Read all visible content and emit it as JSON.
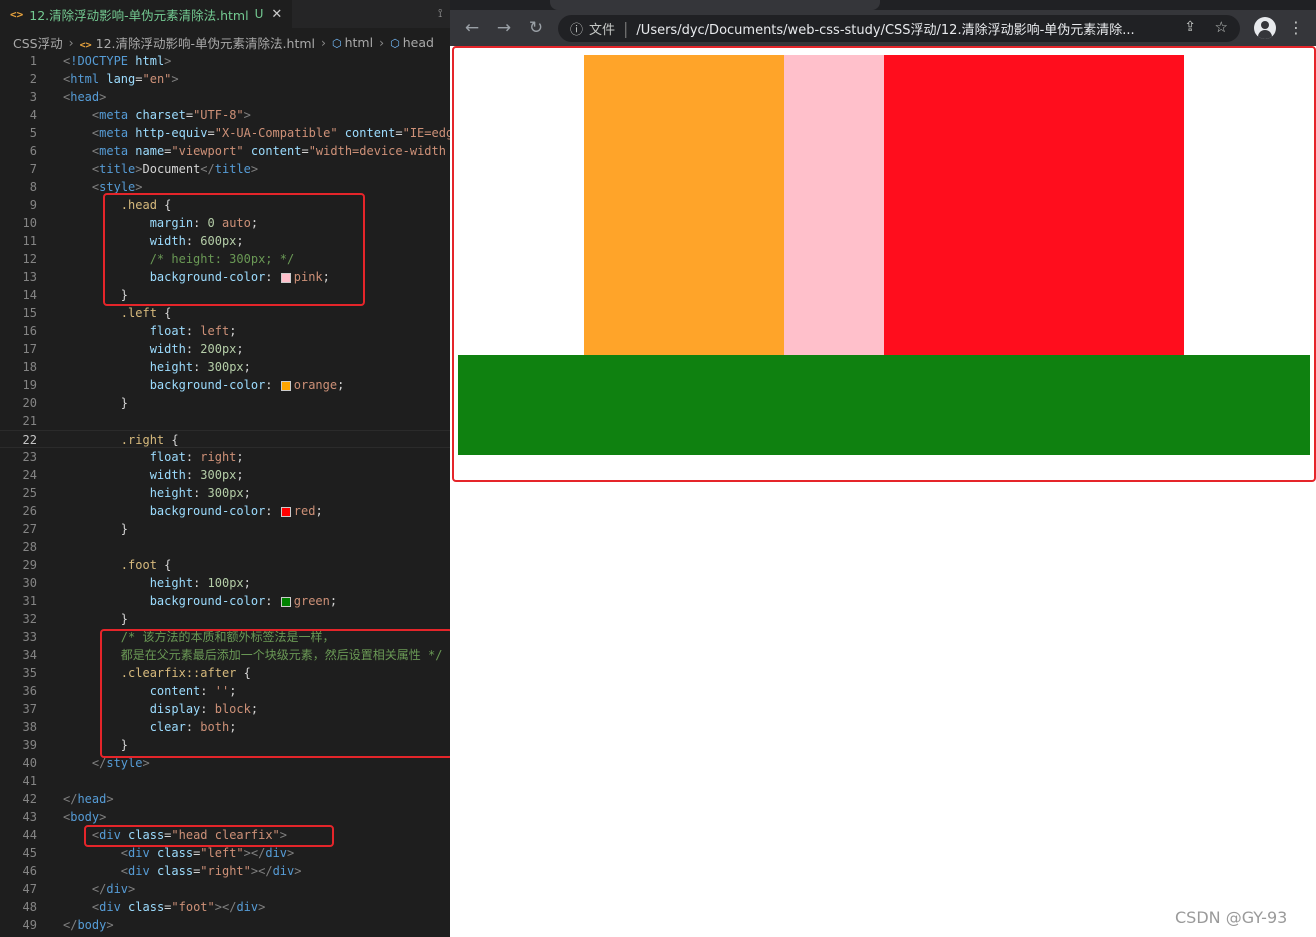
{
  "editor": {
    "tab": {
      "icon": "<>",
      "filename": "12.清除浮动影响-单伪元素清除法.html",
      "status": "U",
      "close": "✕"
    },
    "breadcrumb": [
      {
        "label": "CSS浮动",
        "icon": ""
      },
      {
        "label": "12.清除浮动影响-单伪元素清除法.html",
        "icon": "html-file-icon"
      },
      {
        "label": "html",
        "icon": "cube-icon"
      },
      {
        "label": "head",
        "icon": "cube-icon"
      }
    ],
    "current_line": 22,
    "lines": [
      [
        [
          "t-punc",
          "<"
        ],
        [
          "t-tag",
          "!DOCTYPE "
        ],
        [
          "t-attr",
          "html"
        ],
        [
          "t-punc",
          ">"
        ]
      ],
      [
        [
          "t-punc",
          "<"
        ],
        [
          "t-tag",
          "html "
        ],
        [
          "t-attr",
          "lang"
        ],
        [
          "t-plain",
          "="
        ],
        [
          "t-str",
          "\"en\""
        ],
        [
          "t-punc",
          ">"
        ]
      ],
      [
        [
          "t-punc",
          "<"
        ],
        [
          "t-tag",
          "head"
        ],
        [
          "t-punc",
          ">"
        ]
      ],
      [
        [
          "t-plain",
          "    "
        ],
        [
          "t-punc",
          "<"
        ],
        [
          "t-tag",
          "meta "
        ],
        [
          "t-attr",
          "charset"
        ],
        [
          "t-plain",
          "="
        ],
        [
          "t-str",
          "\"UTF-8\""
        ],
        [
          "t-punc",
          ">"
        ]
      ],
      [
        [
          "t-plain",
          "    "
        ],
        [
          "t-punc",
          "<"
        ],
        [
          "t-tag",
          "meta "
        ],
        [
          "t-attr",
          "http-equiv"
        ],
        [
          "t-plain",
          "="
        ],
        [
          "t-str",
          "\"X-UA-Compatible\" "
        ],
        [
          "t-attr",
          "content"
        ],
        [
          "t-plain",
          "="
        ],
        [
          "t-str",
          "\"IE=edge\""
        ]
      ],
      [
        [
          "t-plain",
          "    "
        ],
        [
          "t-punc",
          "<"
        ],
        [
          "t-tag",
          "meta "
        ],
        [
          "t-attr",
          "name"
        ],
        [
          "t-plain",
          "="
        ],
        [
          "t-str",
          "\"viewport\" "
        ],
        [
          "t-attr",
          "content"
        ],
        [
          "t-plain",
          "="
        ],
        [
          "t-str",
          "\"width=device-width"
        ]
      ],
      [
        [
          "t-plain",
          "    "
        ],
        [
          "t-punc",
          "<"
        ],
        [
          "t-tag",
          "title"
        ],
        [
          "t-punc",
          ">"
        ],
        [
          "t-plain",
          "Document"
        ],
        [
          "t-punc",
          "</"
        ],
        [
          "t-tag",
          "title"
        ],
        [
          "t-punc",
          ">"
        ]
      ],
      [
        [
          "t-plain",
          "    "
        ],
        [
          "t-punc",
          "<"
        ],
        [
          "t-tag",
          "style"
        ],
        [
          "t-punc",
          ">"
        ]
      ],
      [
        [
          "t-plain",
          "        "
        ],
        [
          "t-sel",
          ".head "
        ],
        [
          "t-plain",
          "{"
        ]
      ],
      [
        [
          "t-plain",
          "            "
        ],
        [
          "t-prop",
          "margin"
        ],
        [
          "t-plain",
          ": "
        ],
        [
          "t-num",
          "0 "
        ],
        [
          "t-val",
          "auto"
        ],
        [
          "t-plain",
          ";"
        ]
      ],
      [
        [
          "t-plain",
          "            "
        ],
        [
          "t-prop",
          "width"
        ],
        [
          "t-plain",
          ": "
        ],
        [
          "t-num",
          "600px"
        ],
        [
          "t-plain",
          ";"
        ]
      ],
      [
        [
          "t-plain",
          "            "
        ],
        [
          "t-com",
          "/* height: 300px; */"
        ]
      ],
      [
        [
          "t-plain",
          "            "
        ],
        [
          "t-prop",
          "background-color"
        ],
        [
          "t-plain",
          ": "
        ],
        [
          "swatch",
          "#ffc0cb"
        ],
        [
          "t-val",
          "pink"
        ],
        [
          "t-plain",
          ";"
        ]
      ],
      [
        [
          "t-plain",
          "        }"
        ]
      ],
      [
        [
          "t-plain",
          "        "
        ],
        [
          "t-sel",
          ".left "
        ],
        [
          "t-plain",
          "{"
        ]
      ],
      [
        [
          "t-plain",
          "            "
        ],
        [
          "t-prop",
          "float"
        ],
        [
          "t-plain",
          ": "
        ],
        [
          "t-val",
          "left"
        ],
        [
          "t-plain",
          ";"
        ]
      ],
      [
        [
          "t-plain",
          "            "
        ],
        [
          "t-prop",
          "width"
        ],
        [
          "t-plain",
          ": "
        ],
        [
          "t-num",
          "200px"
        ],
        [
          "t-plain",
          ";"
        ]
      ],
      [
        [
          "t-plain",
          "            "
        ],
        [
          "t-prop",
          "height"
        ],
        [
          "t-plain",
          ": "
        ],
        [
          "t-num",
          "300px"
        ],
        [
          "t-plain",
          ";"
        ]
      ],
      [
        [
          "t-plain",
          "            "
        ],
        [
          "t-prop",
          "background-color"
        ],
        [
          "t-plain",
          ": "
        ],
        [
          "swatch",
          "#ffa500"
        ],
        [
          "t-val",
          "orange"
        ],
        [
          "t-plain",
          ";"
        ]
      ],
      [
        [
          "t-plain",
          "        }"
        ]
      ],
      [],
      [
        [
          "t-plain",
          "        "
        ],
        [
          "t-sel",
          ".right "
        ],
        [
          "t-plain",
          "{"
        ]
      ],
      [
        [
          "t-plain",
          "            "
        ],
        [
          "t-prop",
          "float"
        ],
        [
          "t-plain",
          ": "
        ],
        [
          "t-val",
          "right"
        ],
        [
          "t-plain",
          ";"
        ]
      ],
      [
        [
          "t-plain",
          "            "
        ],
        [
          "t-prop",
          "width"
        ],
        [
          "t-plain",
          ": "
        ],
        [
          "t-num",
          "300px"
        ],
        [
          "t-plain",
          ";"
        ]
      ],
      [
        [
          "t-plain",
          "            "
        ],
        [
          "t-prop",
          "height"
        ],
        [
          "t-plain",
          ": "
        ],
        [
          "t-num",
          "300px"
        ],
        [
          "t-plain",
          ";"
        ]
      ],
      [
        [
          "t-plain",
          "            "
        ],
        [
          "t-prop",
          "background-color"
        ],
        [
          "t-plain",
          ": "
        ],
        [
          "swatch",
          "#ff0000"
        ],
        [
          "t-val",
          "red"
        ],
        [
          "t-plain",
          ";"
        ]
      ],
      [
        [
          "t-plain",
          "        }"
        ]
      ],
      [],
      [
        [
          "t-plain",
          "        "
        ],
        [
          "t-sel",
          ".foot "
        ],
        [
          "t-plain",
          "{"
        ]
      ],
      [
        [
          "t-plain",
          "            "
        ],
        [
          "t-prop",
          "height"
        ],
        [
          "t-plain",
          ": "
        ],
        [
          "t-num",
          "100px"
        ],
        [
          "t-plain",
          ";"
        ]
      ],
      [
        [
          "t-plain",
          "            "
        ],
        [
          "t-prop",
          "background-color"
        ],
        [
          "t-plain",
          ": "
        ],
        [
          "swatch",
          "#008000"
        ],
        [
          "t-val",
          "green"
        ],
        [
          "t-plain",
          ";"
        ]
      ],
      [
        [
          "t-plain",
          "        }"
        ]
      ],
      [
        [
          "t-plain",
          "        "
        ],
        [
          "t-com",
          "/* 该方法的本质和额外标签法是一样，"
        ]
      ],
      [
        [
          "t-plain",
          "        "
        ],
        [
          "t-com",
          "都是在父元素最后添加一个块级元素，然后设置相关属性 */"
        ]
      ],
      [
        [
          "t-plain",
          "        "
        ],
        [
          "t-sel",
          ".clearfix::after "
        ],
        [
          "t-plain",
          "{"
        ]
      ],
      [
        [
          "t-plain",
          "            "
        ],
        [
          "t-prop",
          "content"
        ],
        [
          "t-plain",
          ": "
        ],
        [
          "t-val",
          "''"
        ],
        [
          "t-plain",
          ";"
        ]
      ],
      [
        [
          "t-plain",
          "            "
        ],
        [
          "t-prop",
          "display"
        ],
        [
          "t-plain",
          ": "
        ],
        [
          "t-val",
          "block"
        ],
        [
          "t-plain",
          ";"
        ]
      ],
      [
        [
          "t-plain",
          "            "
        ],
        [
          "t-prop",
          "clear"
        ],
        [
          "t-plain",
          ": "
        ],
        [
          "t-val",
          "both"
        ],
        [
          "t-plain",
          ";"
        ]
      ],
      [
        [
          "t-plain",
          "        }"
        ]
      ],
      [
        [
          "t-plain",
          "    "
        ],
        [
          "t-punc",
          "</"
        ],
        [
          "t-tag",
          "style"
        ],
        [
          "t-punc",
          ">"
        ]
      ],
      [],
      [
        [
          "t-punc",
          "</"
        ],
        [
          "t-tag",
          "head"
        ],
        [
          "t-punc",
          ">"
        ]
      ],
      [
        [
          "t-punc",
          "<"
        ],
        [
          "t-tag",
          "body"
        ],
        [
          "t-punc",
          ">"
        ]
      ],
      [
        [
          "t-plain",
          "    "
        ],
        [
          "t-punc",
          "<"
        ],
        [
          "t-tag",
          "div "
        ],
        [
          "t-attr",
          "class"
        ],
        [
          "t-plain",
          "="
        ],
        [
          "t-str",
          "\"head clearfix\""
        ],
        [
          "t-punc",
          ">"
        ]
      ],
      [
        [
          "t-plain",
          "        "
        ],
        [
          "t-punc",
          "<"
        ],
        [
          "t-tag",
          "div "
        ],
        [
          "t-attr",
          "class"
        ],
        [
          "t-plain",
          "="
        ],
        [
          "t-str",
          "\"left\""
        ],
        [
          "t-punc",
          "></"
        ],
        [
          "t-tag",
          "div"
        ],
        [
          "t-punc",
          ">"
        ]
      ],
      [
        [
          "t-plain",
          "        "
        ],
        [
          "t-punc",
          "<"
        ],
        [
          "t-tag",
          "div "
        ],
        [
          "t-attr",
          "class"
        ],
        [
          "t-plain",
          "="
        ],
        [
          "t-str",
          "\"right\""
        ],
        [
          "t-punc",
          "></"
        ],
        [
          "t-tag",
          "div"
        ],
        [
          "t-punc",
          ">"
        ]
      ],
      [
        [
          "t-plain",
          "    "
        ],
        [
          "t-punc",
          "</"
        ],
        [
          "t-tag",
          "div"
        ],
        [
          "t-punc",
          ">"
        ]
      ],
      [
        [
          "t-plain",
          "    "
        ],
        [
          "t-punc",
          "<"
        ],
        [
          "t-tag",
          "div "
        ],
        [
          "t-attr",
          "class"
        ],
        [
          "t-plain",
          "="
        ],
        [
          "t-str",
          "\"foot\""
        ],
        [
          "t-punc",
          "></"
        ],
        [
          "t-tag",
          "div"
        ],
        [
          "t-punc",
          ">"
        ]
      ],
      [
        [
          "t-punc",
          "</"
        ],
        [
          "t-tag",
          "body"
        ],
        [
          "t-punc",
          ">"
        ]
      ]
    ]
  },
  "browser": {
    "back_icon": "←",
    "forward_icon": "→",
    "reload_icon": "↻",
    "info_icon": "ⓘ",
    "scheme_label": "文件",
    "url": "/Users/dyc/Documents/web-css-study/CSS浮动/12.清除浮动影响-单伪元素清除...",
    "share_icon": "⇪",
    "star_icon": "☆",
    "menu_icon": "⋮"
  },
  "colors": {
    "orange": "#ffa429",
    "pink": "#ffc0cb",
    "red": "#ff0d1d",
    "green": "#0f8110",
    "highlight": "#e5252a"
  },
  "watermark": "CSDN @GY-93"
}
